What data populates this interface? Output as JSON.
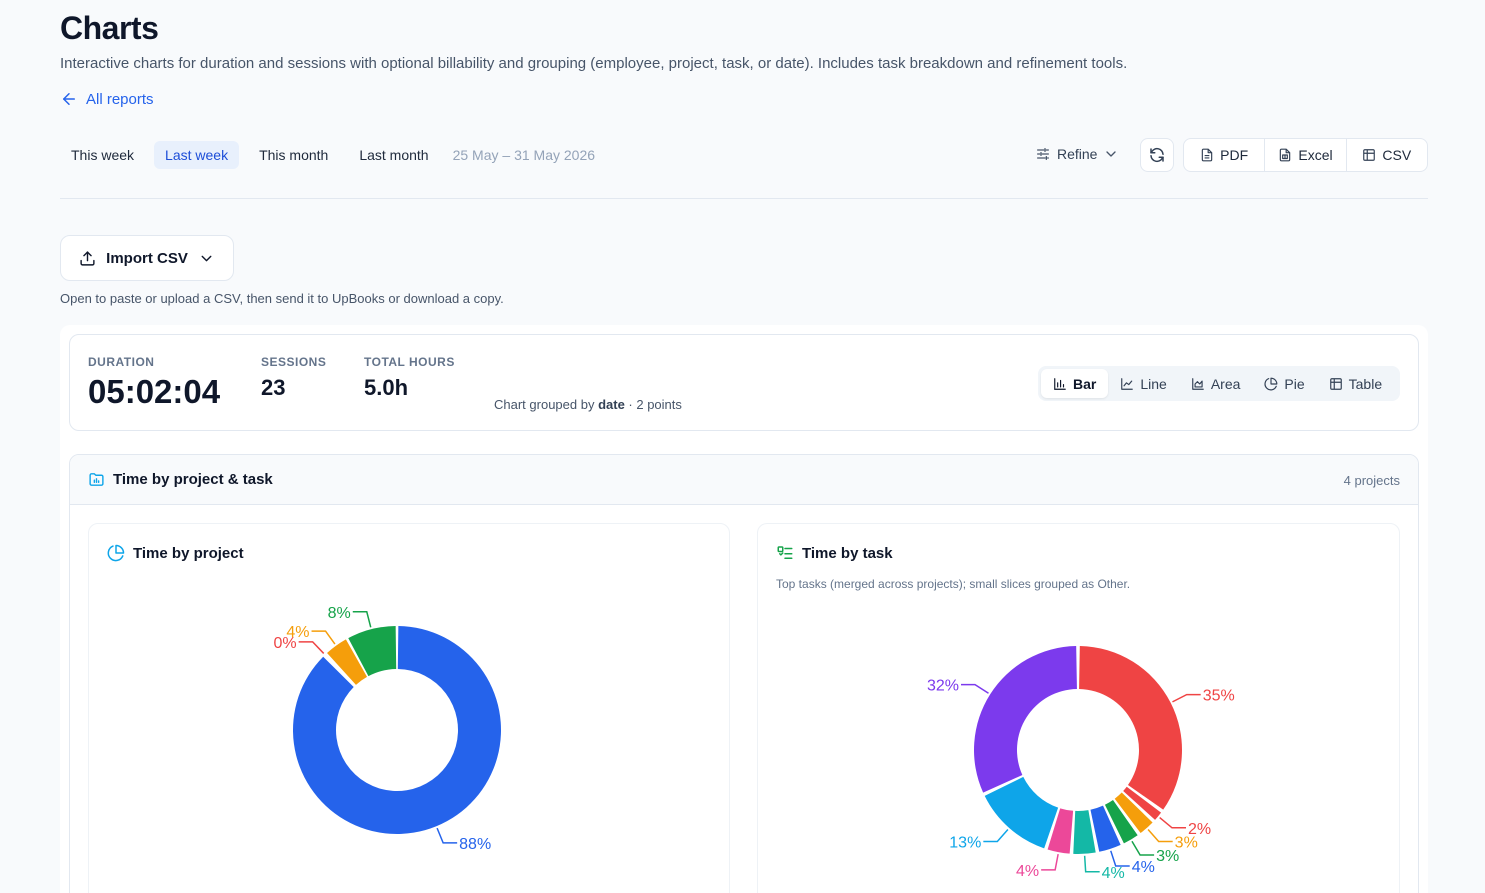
{
  "header": {
    "title": "Charts",
    "subtitle": "Interactive charts for duration and sessions with optional billability and grouping (employee, project, task, or date). Includes task breakdown and refinement tools.",
    "back_label": "All reports"
  },
  "toolbar": {
    "ranges": [
      "This week",
      "Last week",
      "This month",
      "Last month"
    ],
    "active_range": "Last week",
    "date_range": "25 May – 31 May 2026",
    "refine_label": "Refine",
    "exports": [
      "PDF",
      "Excel",
      "CSV"
    ]
  },
  "import": {
    "label": "Import CSV",
    "help": "Open to paste or upload a CSV, then send it to UpBooks or download a copy."
  },
  "stats": {
    "duration_label": "DURATION",
    "duration_value": "05:02:04",
    "sessions_label": "SESSIONS",
    "sessions_value": "23",
    "hours_label": "TOTAL HOURS",
    "hours_value": "5.0h",
    "grouped_prefix": "Chart grouped by ",
    "grouped_key": "date",
    "grouped_suffix": " · 2 points"
  },
  "chart_types": [
    "Bar",
    "Line",
    "Area",
    "Pie",
    "Table"
  ],
  "active_chart_type": "Bar",
  "breakdown": {
    "title": "Time by project & task",
    "count": "4 projects",
    "project_card_title": "Time by project",
    "task_card_title": "Time by task",
    "task_card_subtitle": "Top tasks (merged across projects); small slices grouped as Other."
  },
  "chart_data": [
    {
      "type": "pie",
      "title": "Time by project",
      "labels": [
        "88%",
        "0%",
        "4%",
        "8%"
      ],
      "values": [
        88,
        0.4,
        4,
        8
      ],
      "colors": [
        "#2563eb",
        "#ef4444",
        "#f59e0b",
        "#16a34a"
      ]
    },
    {
      "type": "pie",
      "title": "Time by task",
      "labels": [
        "35%",
        "2%",
        "3%",
        "3%",
        "4%",
        "4%",
        "4%",
        "13%",
        "32%"
      ],
      "values": [
        35,
        2,
        3,
        3,
        4,
        4,
        4,
        13,
        32
      ],
      "colors": [
        "#ef4444",
        "#ef4444",
        "#f59e0b",
        "#16a34a",
        "#2563eb",
        "#14b8a6",
        "#ec4899",
        "#0ea5e9",
        "#7c3aed"
      ]
    }
  ]
}
